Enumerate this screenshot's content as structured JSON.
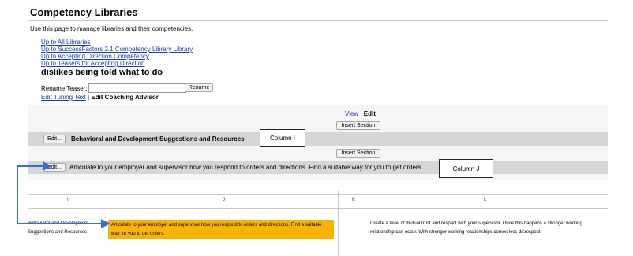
{
  "page": {
    "title": "Competency Libraries",
    "subtitle": "Use this page to manage libraries and their competencies."
  },
  "breadcrumbs": [
    "Up to All Libraries",
    "Up to SuccessFactors 2.1 Competency Library Library",
    "Up to Accepting Direction Competency",
    "Up to Teasers for Accepting Direction"
  ],
  "teaser_title": "dislikes being told what to do",
  "rename": {
    "label": "Rename Teaser:",
    "value": "",
    "button": "Rename"
  },
  "subnav": {
    "link": "Edit Tuning Text",
    "separator": "|",
    "current": "Edit Coaching Advisor"
  },
  "view_edit": {
    "view": "View",
    "separator": "|",
    "edit": "Edit"
  },
  "sections": {
    "insert_label": "Insert Section",
    "edit_label": "Edit...",
    "section1_title": "Behavioral and Development Suggestions and Resources",
    "section2_text": "Articulate to your employer and supervisor how you respond to orders and directions. Find a suitable way for you to get orders."
  },
  "callouts": {
    "column_i": "Column I",
    "column_j": "Column J"
  },
  "spreadsheet": {
    "columns": [
      "I",
      "J",
      "K",
      "L"
    ],
    "row": {
      "i": "Behavioral and Development Suggestions and Resources",
      "j": "Articulate to your employer and supervisor how you respond to orders and directions. Find a suitable way for you to get orders.",
      "k": "",
      "l": "Create a level of mutual trust and respect with your supervisor. Once this happens a stronger working relationship can occur. With stronger working relationships comes less disrespect."
    }
  },
  "colors": {
    "link": "#1a3fa8",
    "band": "#d6d6d6",
    "highlight": "#f6b400",
    "arrow": "#3a6bd1"
  }
}
